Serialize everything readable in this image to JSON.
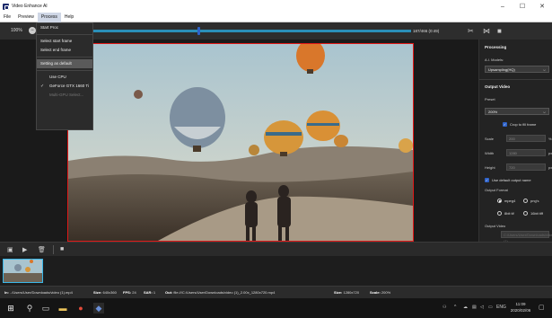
{
  "window": {
    "title": "Video Enhance AI",
    "minimize": "–",
    "maximize": "☐",
    "close": "✕"
  },
  "menubar": {
    "items": [
      "File",
      "Preview",
      "Process",
      "Help"
    ]
  },
  "process_menu": {
    "items": [
      {
        "label": "Start Proc",
        "state": "normal"
      },
      {
        "label": "Select start frame",
        "state": "normal"
      },
      {
        "label": "Select end frame",
        "state": "normal"
      },
      {
        "label": "Setting as default",
        "state": "hover"
      },
      {
        "label": "Use CPU",
        "state": "normal"
      },
      {
        "label": "GeForce GTX 1660 Ti",
        "state": "checked"
      },
      {
        "label": "Multi-GPU Select...",
        "state": "disabled"
      }
    ]
  },
  "toolbar": {
    "zoom": "100%",
    "zoom_btn": "−",
    "frame_count": "187/466  (0:49)"
  },
  "panel": {
    "processing_header": "Processing",
    "ai_models_label": "A.I. Models:",
    "ai_model_value": "Upsampling(HQ)",
    "output_video_header": "Output Video",
    "preset_label": "Preset",
    "preset_value": "200%",
    "crop_label": "Crop to fill frame",
    "scale_label": "Scale",
    "scale_value": "200",
    "scale_unit": "%",
    "width_label": "Width",
    "width_value": "1280",
    "width_unit": "px",
    "height_label": "Height",
    "height_value": "720",
    "height_unit": "px",
    "default_name_label": "Use default output name",
    "output_format_label": "Output Format",
    "format_options": [
      "mpeg4",
      "png's",
      "8bit tif",
      "16bit tiff"
    ],
    "selected_format": "mpeg4",
    "output_video_label": "Output Video",
    "output_video_path": "C:/Users/User/Downloads/video (1)"
  },
  "status": {
    "in_label": "In:",
    "in_path": "../Users/User/Downloads/video (1).mp4",
    "size_label": "Size:",
    "in_size": "640x360",
    "fps_label": "FPS:",
    "fps": "24",
    "sar_label": "SAR:",
    "sar": "1",
    "out_label": "Out:",
    "out_path": "file:///C:/Users/User/Downloads/video (1)_2.00x_1280x720.mp4",
    "out_size": "1280x720",
    "scale_label": "Scale:",
    "scale": "200%"
  },
  "taskbar": {
    "lang": "ENG",
    "time": "11:09",
    "date": "2020/02/06"
  },
  "colors": {
    "accent": "#2e62c9",
    "timeline": "#2a8fb8",
    "frame_border": "#e01818",
    "thumb_border": "#3ab7e8"
  }
}
